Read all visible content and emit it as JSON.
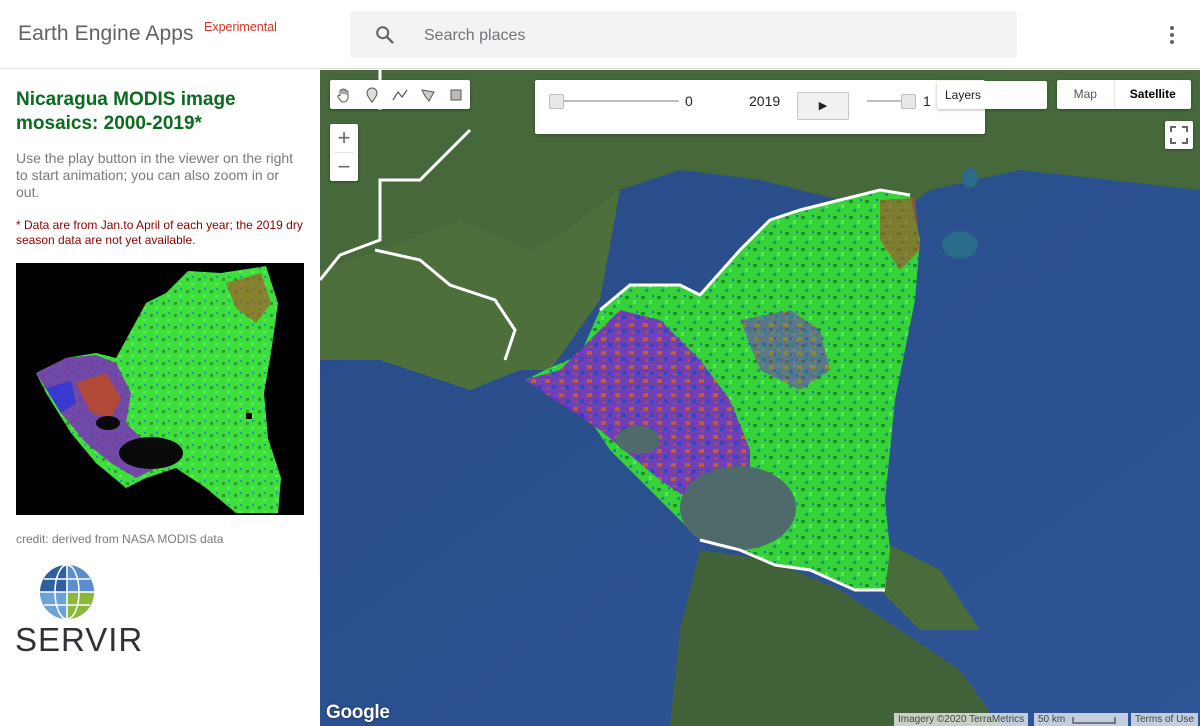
{
  "header": {
    "brand": "Earth Engine Apps",
    "badge": "Experimental",
    "search_placeholder": "Search places"
  },
  "panel": {
    "title": "Nicaragua MODIS image mosaics: 2000-2019*",
    "description": "Use the play button in the viewer on the right to start animation; you can also zoom in or out.",
    "note": "* Data are from Jan.to April of each year; the 2019 dry season data are not yet available.",
    "credit": "credit: derived from NASA MODIS data",
    "logo_text": "SERVIR"
  },
  "map": {
    "animation": {
      "slider1_value": "0",
      "year": "2019",
      "play_label": "▶",
      "slider2_value": "1"
    },
    "layers_label": "Layers",
    "map_type": {
      "map_label": "Map",
      "satellite_label": "Satellite",
      "selected": "Satellite"
    },
    "zoom_in": "+",
    "zoom_out": "−",
    "google_logo": "Google",
    "imagery_credit": "Imagery ©2020 TerraMetrics",
    "scale": "50 km",
    "terms": "Terms of Use"
  },
  "colors": {
    "title_green": "#0b6b1f",
    "note_red": "#8b0000",
    "badge_red": "#d93025",
    "ocean": "#2c4f8c",
    "land": "#4a6b3a"
  }
}
